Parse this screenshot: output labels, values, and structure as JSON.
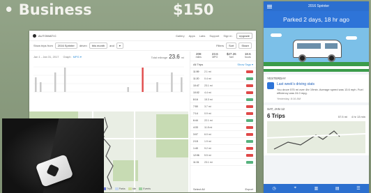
{
  "slide": {
    "title": "• Business",
    "price": "$150"
  },
  "desktop": {
    "brand": "AUTOMATIC",
    "nav": [
      "Gallery",
      "Apps",
      "Labs",
      "Support"
    ],
    "user": "Sign in",
    "signup": "Upgrade",
    "filter_prefix": "Show trips from",
    "vehicle": "2016 Sprinter",
    "filter_mid": "driven",
    "period": "this month",
    "filter_and": "and",
    "filter_tail": "▾",
    "filters_label": "Filters",
    "btn_a": "Sort",
    "btn_b": "Share",
    "date_range": "Jan 1 - Jan 31, 2017",
    "graph_label": "Graph",
    "graph_link": "MPG ▾",
    "total_label": "Total mileage",
    "total_value": "23.6",
    "total_unit": "mi",
    "chart_data": {
      "type": "bar",
      "values": [
        3,
        2,
        0,
        0,
        4,
        0,
        5,
        0,
        0,
        0,
        0,
        0,
        0,
        0,
        0,
        0,
        0,
        0,
        0,
        1,
        0,
        0,
        5,
        0,
        0,
        2,
        0,
        0,
        4,
        0,
        3
      ],
      "highlight_index": 22,
      "ylim": [
        0,
        6
      ]
    },
    "legend": [
      "Trips",
      "Parks",
      "Idle",
      "Events"
    ],
    "stats": [
      {
        "value": "208",
        "label": "miles"
      },
      {
        "value": "23.6",
        "label": "MPG"
      },
      {
        "value": "$27.26",
        "label": "fuel"
      },
      {
        "value": "18.6",
        "label": "hours"
      }
    ],
    "trips_label": "All Trips",
    "trips_link": "Show Tags ▾",
    "trips": [
      {
        "time": "11:59",
        "dist": "2.1 mi"
      },
      {
        "time": "11:20",
        "dist": "0.4 mi"
      },
      {
        "time": "10:47",
        "dist": "23.1 mi"
      },
      {
        "time": "10:02",
        "dist": "4.4 mi"
      },
      {
        "time": "8:16",
        "dist": "15.3 mi"
      },
      {
        "time": "7:50",
        "dist": "3.7 mi"
      },
      {
        "time": "7:14",
        "dist": "0.9 mi"
      },
      {
        "time": "6:44",
        "dist": "22.1 mi"
      },
      {
        "time": "4:33",
        "dist": "11.8 mi"
      },
      {
        "time": "3:07",
        "dist": "6.0 mi"
      },
      {
        "time": "2:15",
        "dist": "1.9 mi"
      },
      {
        "time": "1:40",
        "dist": "9.2 mi"
      },
      {
        "time": "12:06",
        "dist": "5.5 mi"
      },
      {
        "time": "11:31",
        "dist": "23.1 mi"
      }
    ],
    "select_all": "Select All",
    "export": "Export"
  },
  "phone": {
    "title": "2016 Sprinter",
    "parked": "Parked 2 days, 18 hr ago",
    "yesterday_label": "YESTERDAY",
    "card_title": "Last week's driving stats",
    "card_text": "You drove 575 mi over 4hr 19min. Average speed was 13.6 mph. Fuel efficiency was 24.0 mpg.",
    "card_time": "Yesterday, 8:16 AM",
    "date_label": "SAT, JAN 12",
    "trip_count": "6 Trips",
    "trip_distance": "57.5 mi",
    "trip_duration": "4 hr 13 min",
    "tabs": [
      "◷",
      "⌖",
      "▥",
      "▤",
      "☰"
    ]
  }
}
